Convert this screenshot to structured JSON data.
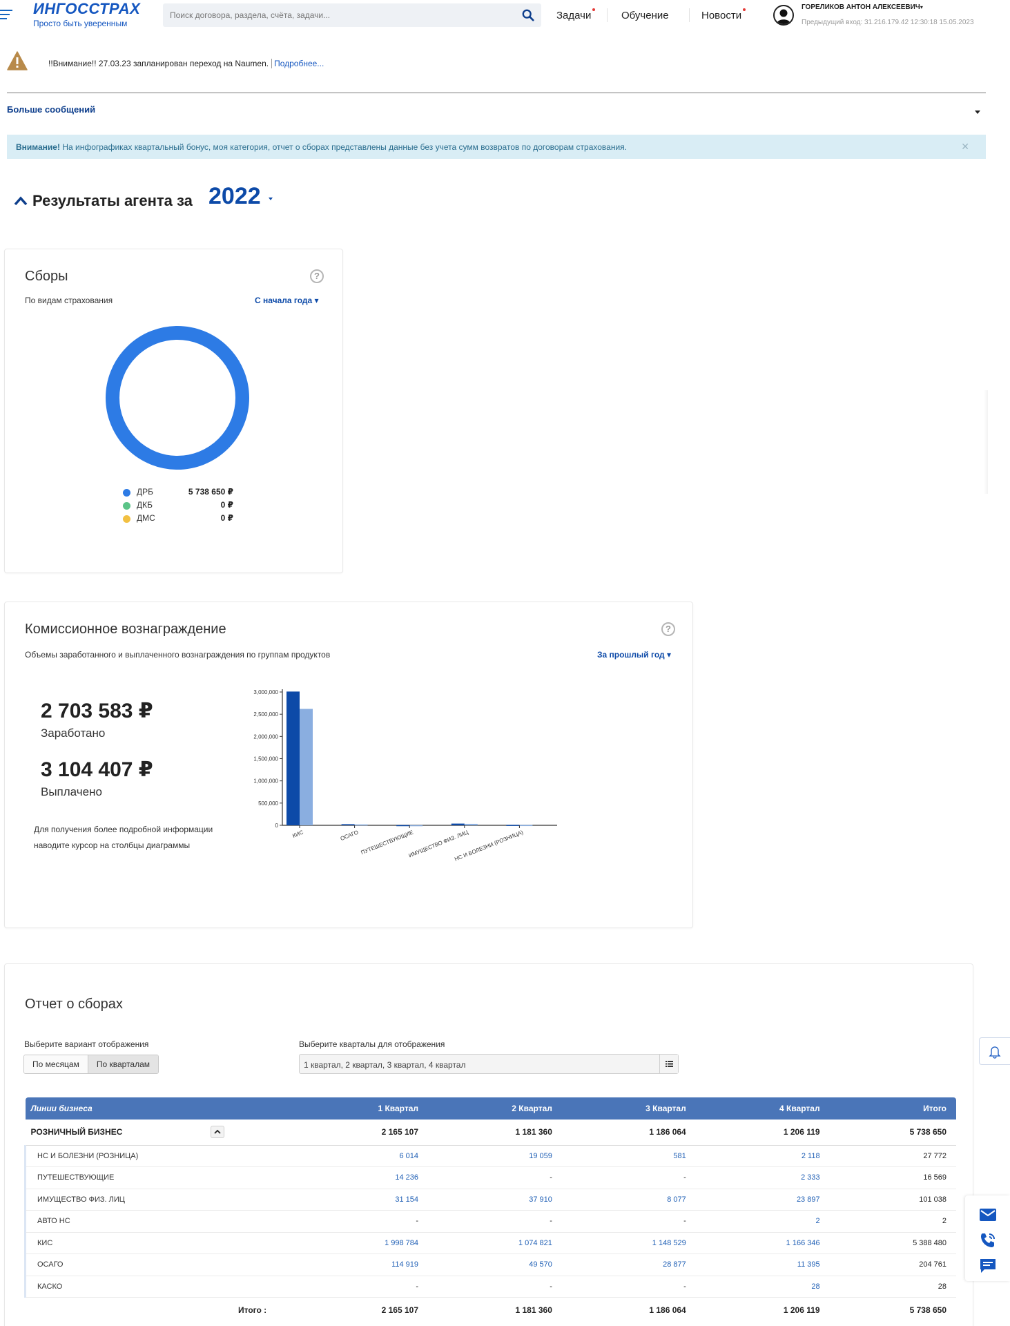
{
  "header": {
    "logo_title": "ИНГОССТРАХ",
    "logo_subtitle": "Просто быть уверенным",
    "search_placeholder": "Поиск договора, раздела, счёта, задачи...",
    "nav": [
      {
        "label": "Задачи",
        "badge": true
      },
      {
        "label": "Обучение",
        "badge": false
      },
      {
        "label": "Новости",
        "badge": true
      }
    ],
    "user_name": "ГОРЕЛИКОВ АНТОН АЛЕКСЕЕВИЧ",
    "prev_login": "Предыдущий вход: 31.216.179.42 12:30:18 15.05.2023"
  },
  "warning": {
    "text": "!!Внимание!! 27.03.23 запланирован переход на Naumen.",
    "link": "Подробнее..."
  },
  "more_messages": "Больше сообщений",
  "info_bar": {
    "strong": "Внимание!",
    "text": " На инфографиках квартальный бонус, моя категория, отчет о сборах представлены данные без учета сумм возвратов по договорам страхования."
  },
  "results": {
    "title": "Результаты агента за",
    "year": "2022"
  },
  "collections": {
    "title": "Сборы",
    "subtitle": "По видам страхования",
    "period": "С начала года ▾",
    "help": "?",
    "legend": [
      {
        "label": "ДРБ",
        "value": "5 738 650 ₽",
        "color": "#2d7be5"
      },
      {
        "label": "ДКБ",
        "value": "0 ₽",
        "color": "#5cc488"
      },
      {
        "label": "ДМС",
        "value": "0 ₽",
        "color": "#f2c042"
      }
    ]
  },
  "commission": {
    "title": "Комиссионное вознаграждение",
    "subtitle": "Объемы заработанного и выплаченного вознаграждения по группам продуктов",
    "period": "За прошлый год ▾",
    "help": "?",
    "earned_value": "2 703 583 ₽",
    "earned_label": "Заработано",
    "paid_value": "3 104 407 ₽",
    "paid_label": "Выплачено",
    "hint_line1": "Для получения более подробной информации",
    "hint_line2": "наводите курсор на столбцы диаграммы"
  },
  "chart_data": {
    "type": "bar",
    "categories": [
      "КИС",
      "ОСАГО",
      "ПУТЕШЕСТВУЮЩИЕ",
      "ИМУЩЕСТВО ФИЗ. ЛИЦ",
      "НС И БОЛЕЗНИ (РОЗНИЦА)"
    ],
    "series": [
      {
        "values": [
          3010000,
          25000,
          4000,
          38000,
          9000
        ],
        "color": "#0d4aa8"
      },
      {
        "values": [
          2620000,
          20000,
          3000,
          32000,
          7000
        ],
        "color": "#8aaee0"
      }
    ],
    "yticks": [
      "0",
      "500,000",
      "1,000,000",
      "1,500,000",
      "2,000,000",
      "2,500,000",
      "3,000,000"
    ],
    "ylim": [
      0,
      3000000
    ],
    "grid": false
  },
  "report": {
    "title": "Отчет о сборах",
    "mode_label": "Выберите вариант отображения",
    "mode_options": [
      "По месяцам",
      "По кварталам"
    ],
    "quarters_label": "Выберите кварталы для отображения",
    "quarters_value": "1 квартал, 2 квартал, 3 квартал, 4 квартал",
    "columns": [
      "Линии бизнеса",
      "1 Квартал",
      "2 Квартал",
      "3 Квартал",
      "4 Квартал",
      "Итого"
    ],
    "group": {
      "name": "РОЗНИЧНЫЙ БИЗНЕС",
      "values": [
        "2 165 107",
        "1 181 360",
        "1 186 064",
        "1 206 119",
        "5 738 650"
      ]
    },
    "rows": [
      {
        "name": "НС И БОЛЕЗНИ (РОЗНИЦА)",
        "values": [
          "6 014",
          "19 059",
          "581",
          "2 118",
          "27 772"
        ]
      },
      {
        "name": "ПУТЕШЕСТВУЮЩИЕ",
        "values": [
          "14 236",
          "-",
          "-",
          "2 333",
          "16 569"
        ]
      },
      {
        "name": "ИМУЩЕСТВО ФИЗ. ЛИЦ",
        "values": [
          "31 154",
          "37 910",
          "8 077",
          "23 897",
          "101 038"
        ]
      },
      {
        "name": "АВТО НС",
        "values": [
          "-",
          "-",
          "-",
          "2",
          "2"
        ]
      },
      {
        "name": "КИС",
        "values": [
          "1 998 784",
          "1 074 821",
          "1 148 529",
          "1 166 346",
          "5 388 480"
        ]
      },
      {
        "name": "ОСАГО",
        "values": [
          "114 919",
          "49 570",
          "28 877",
          "11 395",
          "204 761"
        ]
      },
      {
        "name": "КАСКО",
        "values": [
          "-",
          "-",
          "-",
          "28",
          "28"
        ]
      }
    ],
    "footer": {
      "label": "Итого :",
      "values": [
        "2 165 107",
        "1 181 360",
        "1 186 064",
        "1 206 119",
        "5 738 650"
      ]
    }
  }
}
